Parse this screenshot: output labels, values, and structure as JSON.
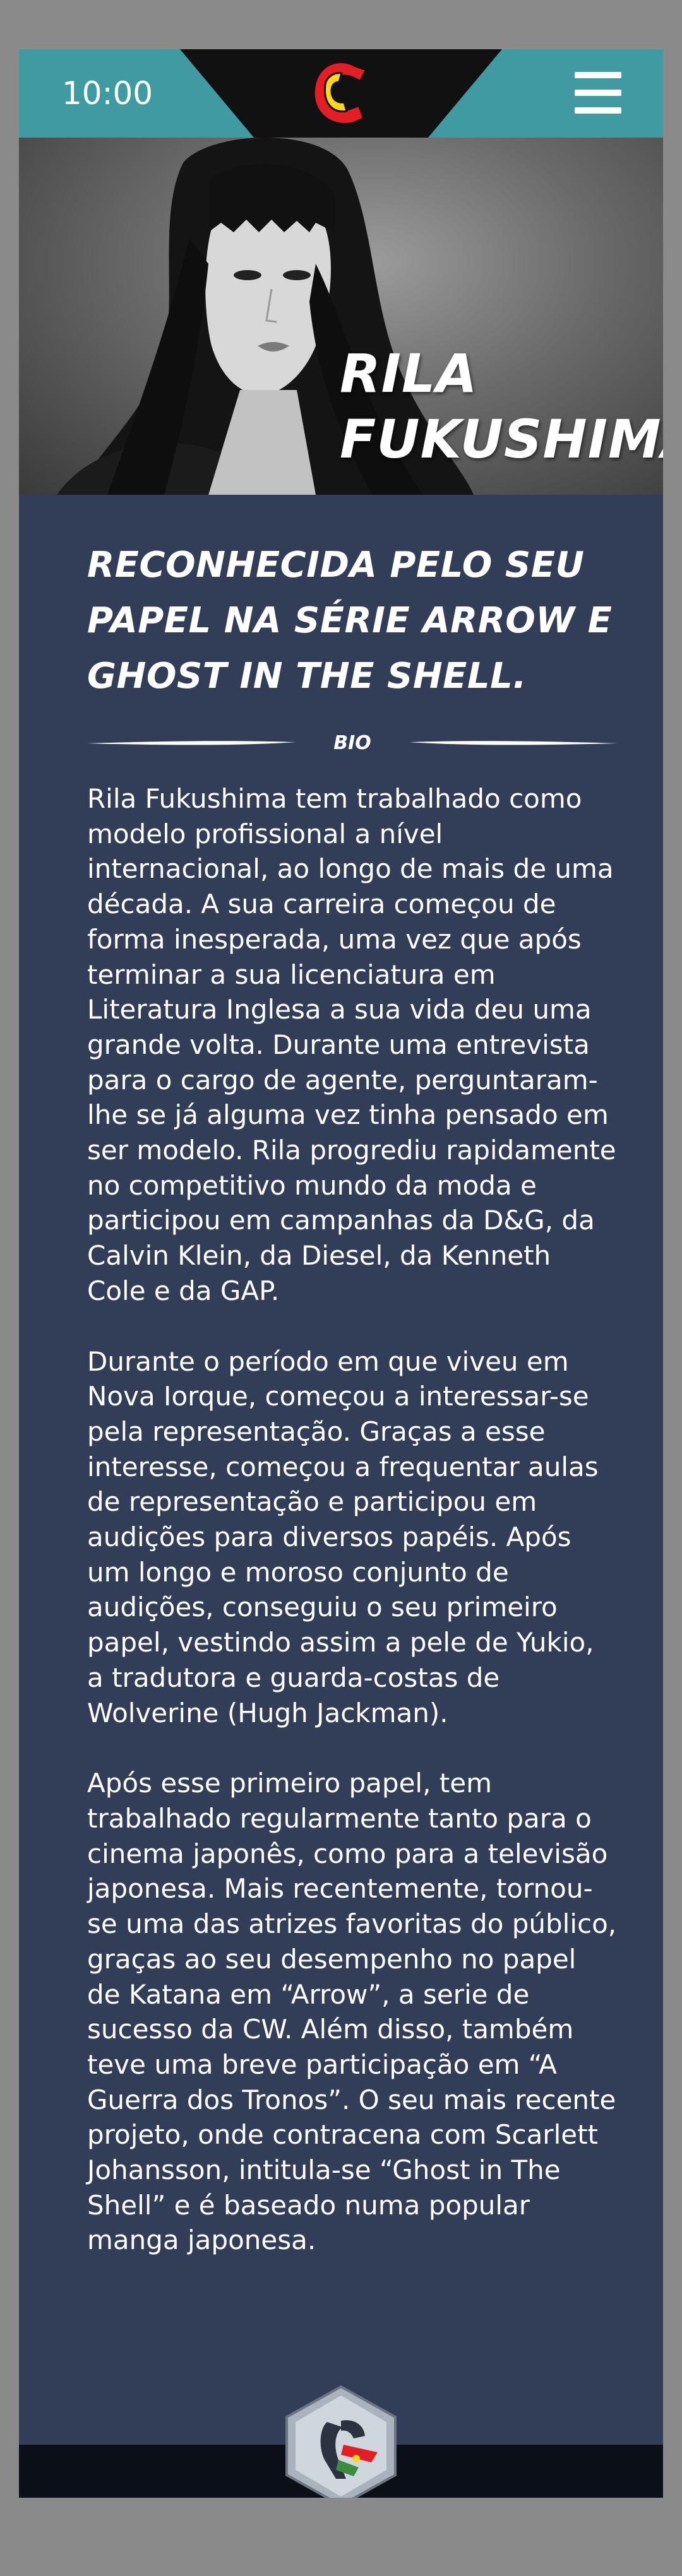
{
  "status": {
    "time": "10:00"
  },
  "header": {
    "logo_icon": "comic-c-logo",
    "menu_icon": "hamburger-menu-icon",
    "bar_color": "#3f9aa1",
    "notch_color": "#111111"
  },
  "hero": {
    "name_line1": "RILA",
    "name_line2": "FUKUSHIMA"
  },
  "article": {
    "headline_line1": "RECONHECIDA PELO SEU",
    "headline_line2": "PAPEL NA SÉRIE ARROW E",
    "headline_line3": "GHOST IN THE SHELL.",
    "section_label": "BIO",
    "paragraphs": [
      "Rila Fukushima tem trabalhado como modelo profissional a nível internacional, ao longo de mais de uma década. A sua carreira começou de forma inesperada, uma vez que após terminar a sua licenciatura em Literatura Inglesa a sua vida deu uma grande volta. Durante uma entrevista para o cargo de agente, perguntaram-lhe se já alguma vez tinha pensado em ser modelo. Rila progrediu rapidamente no competitivo mundo da moda e participou em campanhas da D&G, da Calvin Klein, da Diesel, da Kenneth Cole e da GAP.",
      "Durante o período em que viveu em Nova Iorque, começou a interessar-se pela representação. Graças a esse interesse, começou a frequentar aulas de representação e participou em audições para diversos papéis. Após um longo e moroso conjunto de audições, conseguiu o seu primeiro papel, vestindo assim a pele de Yukio, a tradutora e guarda-costas de Wolverine (Hugh Jackman).",
      "Após esse primeiro papel, tem trabalhado regularmente tanto para o cinema japonês, como para a televisão japonesa. Mais recentemente, tornou-se uma das atrizes favoritas do público, graças ao seu desempenho no papel de Katana em “Arrow”, a serie de sucesso da CW. Além disso, também teve uma breve participação em “A Guerra dos Tronos”. O seu mais recente projeto, onde contracena com Scarlett Johansson, intitula-se “Ghost in The Shell” e é baseado numa popular manga japonesa."
    ]
  },
  "footer": {
    "badge_icon": "hexagon-character-badge-icon",
    "content_bg": "#323e58"
  }
}
